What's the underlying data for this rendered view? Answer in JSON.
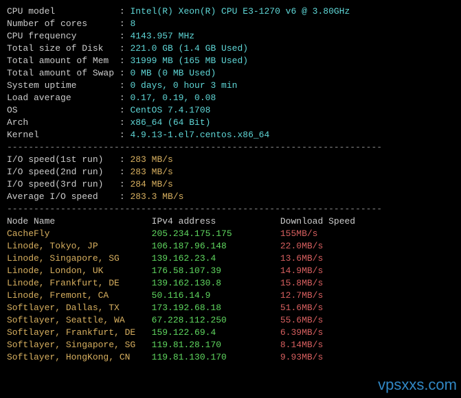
{
  "sys": [
    {
      "label": "CPU model            ",
      "value": "Intel(R) Xeon(R) CPU E3-1270 v6 @ 3.80GHz"
    },
    {
      "label": "Number of cores      ",
      "value": "8"
    },
    {
      "label": "CPU frequency        ",
      "value": "4143.957 MHz"
    },
    {
      "label": "Total size of Disk   ",
      "value": "221.0 GB (1.4 GB Used)"
    },
    {
      "label": "Total amount of Mem  ",
      "value": "31999 MB (165 MB Used)"
    },
    {
      "label": "Total amount of Swap ",
      "value": "0 MB (0 MB Used)"
    },
    {
      "label": "System uptime        ",
      "value": "0 days, 0 hour 3 min"
    },
    {
      "label": "Load average         ",
      "value": "0.17, 0.19, 0.08"
    },
    {
      "label": "OS                   ",
      "value": "CentOS 7.4.1708"
    },
    {
      "label": "Arch                 ",
      "value": "x86_64 (64 Bit)"
    },
    {
      "label": "Kernel               ",
      "value": "4.9.13-1.el7.centos.x86_64"
    }
  ],
  "divider": "----------------------------------------------------------------------",
  "io": [
    {
      "label": "I/O speed(1st run)   ",
      "value": "283 MB/s"
    },
    {
      "label": "I/O speed(2nd run)   ",
      "value": "283 MB/s"
    },
    {
      "label": "I/O speed(3rd run)   ",
      "value": "284 MB/s"
    },
    {
      "label": "Average I/O speed    ",
      "value": "283.3 MB/s"
    }
  ],
  "table_header": {
    "c1": "Node Name",
    "c2": "IPv4 address",
    "c3": "Download Speed"
  },
  "nodes": [
    {
      "name": "CacheFly",
      "ip": "205.234.175.175",
      "speed": "155MB/s",
      "c": "red"
    },
    {
      "name": "Linode, Tokyo, JP",
      "ip": "106.187.96.148",
      "speed": "22.0MB/s",
      "c": "red"
    },
    {
      "name": "Linode, Singapore, SG",
      "ip": "139.162.23.4",
      "speed": "13.6MB/s",
      "c": "red"
    },
    {
      "name": "Linode, London, UK",
      "ip": "176.58.107.39",
      "speed": "14.9MB/s",
      "c": "red"
    },
    {
      "name": "Linode, Frankfurt, DE",
      "ip": "139.162.130.8",
      "speed": "15.8MB/s",
      "c": "red"
    },
    {
      "name": "Linode, Fremont, CA",
      "ip": "50.116.14.9",
      "speed": "12.7MB/s",
      "c": "red"
    },
    {
      "name": "Softlayer, Dallas, TX",
      "ip": "173.192.68.18",
      "speed": "51.6MB/s",
      "c": "red"
    },
    {
      "name": "Softlayer, Seattle, WA",
      "ip": "67.228.112.250",
      "speed": "55.6MB/s",
      "c": "red"
    },
    {
      "name": "Softlayer, Frankfurt, DE",
      "ip": "159.122.69.4",
      "speed": "6.39MB/s",
      "c": "red"
    },
    {
      "name": "Softlayer, Singapore, SG",
      "ip": "119.81.28.170",
      "speed": "8.14MB/s",
      "c": "red"
    },
    {
      "name": "Softlayer, HongKong, CN",
      "ip": "119.81.130.170",
      "speed": "9.93MB/s",
      "c": "red"
    }
  ],
  "watermark": "vpsxxs.com"
}
